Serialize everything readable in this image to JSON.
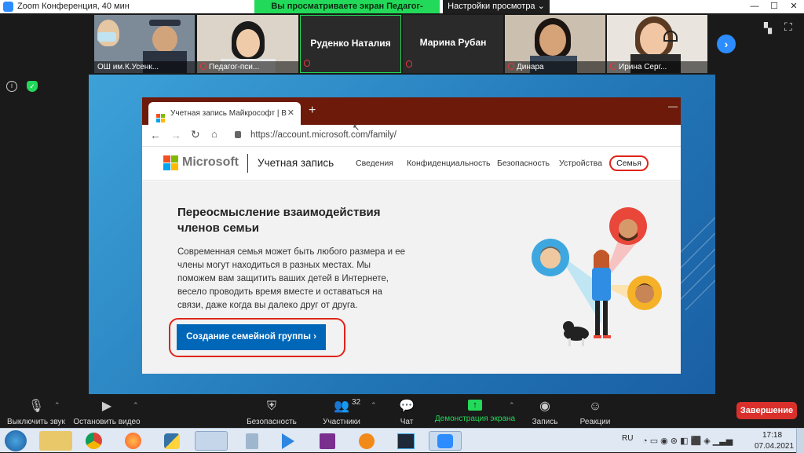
{
  "window": {
    "title": "Zoom Конференция, 40 мин",
    "share_banner": "Вы просматриваете экран Педагог-психолог",
    "view_options": "Настройки просмотра"
  },
  "participants": [
    {
      "name": "ОШ им.К.Усенк...",
      "muted": false,
      "video": true,
      "bg": "#6b7a8c",
      "skin": "#e0b48e"
    },
    {
      "name": "Педагог-пси...",
      "muted": true,
      "video": true,
      "bg": "#d9cfc4",
      "skin": "#f0cba9"
    },
    {
      "name": "Руденко Наталия",
      "muted": true,
      "video": false
    },
    {
      "name": "Марина Рубан",
      "muted": true,
      "video": false
    },
    {
      "name": "Динара",
      "muted": true,
      "video": true,
      "bg": "#c6b7a8",
      "skin": "#d6a277"
    },
    {
      "name": "Ирина Серг...",
      "muted": true,
      "video": true,
      "bg": "#e6e2da",
      "skin": "#f1c6a4"
    }
  ],
  "shared_screen": {
    "tab_title": "Учетная запись Майкрософт | В",
    "new_tab": "+",
    "url": "https://account.microsoft.com/family/",
    "ms_brand": "Microsoft",
    "account_label": "Учетная запись",
    "nav": [
      "Сведения",
      "Конфиденциальность",
      "Безопасность",
      "Устройства"
    ],
    "nav_active": "Семья",
    "heading": "Переосмысление взаимодействия членов семьи",
    "body_text": "Современная семья может быть любого размера и ее члены могут находиться в разных местах. Мы поможем вам защитить ваших детей в Интернете, весело проводить время вместе и оставаться на связи, даже когда вы далеко друг от друга.",
    "cta_button": "Создание семейной группы ›"
  },
  "controls": {
    "mute": "Выключить звук",
    "video": "Остановить видео",
    "security": "Безопасность",
    "participants": "Участники",
    "participants_count": "32",
    "chat": "Чат",
    "share": "Демонстрация экрана",
    "record": "Запись",
    "reactions": "Реакции",
    "end": "Завершение"
  },
  "taskbar": {
    "lang": "RU",
    "time": "17:18",
    "date": "07.04.2021"
  },
  "colors": {
    "zoom_green": "#23d959",
    "end_red": "#d9302c",
    "ms_blue": "#0067b8",
    "tab_bar": "#6d1a0a",
    "highlight_red": "#e0241a"
  }
}
